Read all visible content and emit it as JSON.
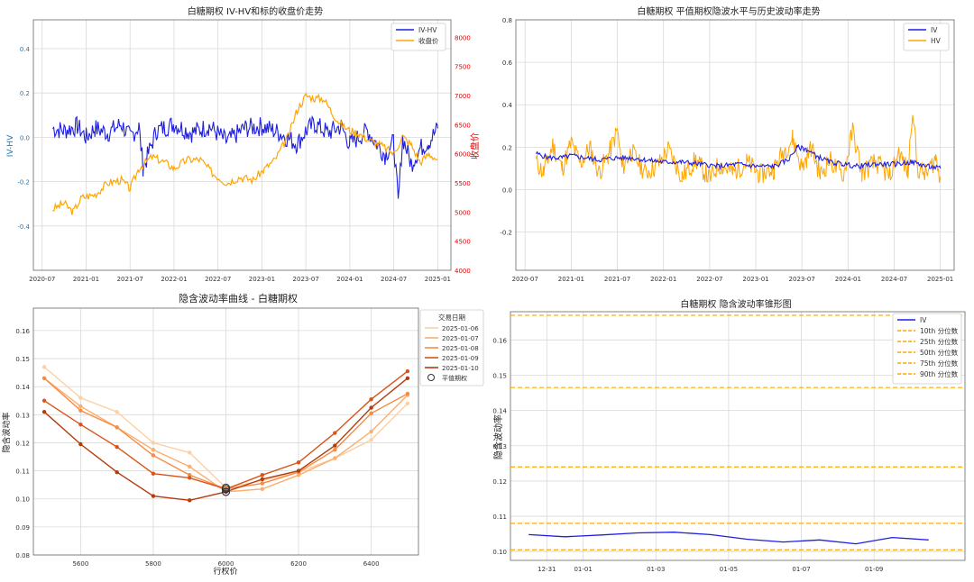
{
  "chart_data": [
    {
      "type": "line",
      "title": "白糖期权 IV-HV和标的收盘价走势",
      "ylabel": "IV-HV",
      "y2label": "收盘价",
      "ylim": [
        -0.6,
        0.53
      ],
      "y2lim": [
        4000,
        8300
      ],
      "yticks": [
        "-0.4",
        "-0.2",
        "0.0",
        "0.2",
        "0.4"
      ],
      "y2ticks": [
        "4000",
        "4500",
        "5000",
        "5500",
        "6000",
        "6500",
        "7000",
        "7500",
        "8000"
      ],
      "xticks": [
        "2020-07",
        "2021-01",
        "2021-07",
        "2022-01",
        "2022-07",
        "2023-01",
        "2023-07",
        "2024-01",
        "2024-07",
        "2025-01"
      ],
      "legend": [
        "IV-HV",
        "收盘价"
      ],
      "legend_position": "top-right",
      "grid": true,
      "colors": {
        "series1": "#1f1fe0",
        "series2": "#ffa500",
        "left_axis": "#1f77b4",
        "right_axis": "#e00000"
      },
      "series": [
        {
          "name": "IV-HV",
          "x": [
            2020.62,
            2020.75,
            2020.9,
            2021.0,
            2021.1,
            2021.25,
            2021.4,
            2021.5,
            2021.6,
            2021.65,
            2021.8,
            2022.0,
            2022.2,
            2022.4,
            2022.6,
            2022.8,
            2023.0,
            2023.2,
            2023.4,
            2023.5,
            2023.6,
            2023.75,
            2023.9,
            2024.0,
            2024.2,
            2024.4,
            2024.5,
            2024.55,
            2024.6,
            2024.7,
            2024.8,
            2024.9,
            2025.0
          ],
          "values": [
            0.04,
            0.03,
            0.05,
            0.0,
            0.04,
            0.02,
            0.06,
            0.0,
            0.05,
            -0.14,
            0.03,
            0.06,
            0.02,
            0.05,
            -0.02,
            0.04,
            0.05,
            0.02,
            -0.03,
            0.03,
            0.06,
            0.02,
            0.05,
            -0.03,
            0.03,
            -0.08,
            -0.02,
            -0.3,
            0.0,
            -0.12,
            -0.05,
            -0.02,
            0.04
          ]
        },
        {
          "name": "收盘价",
          "x": [
            2020.62,
            2020.75,
            2020.85,
            2020.95,
            2021.1,
            2021.25,
            2021.4,
            2021.5,
            2021.6,
            2021.75,
            2021.9,
            2022.0,
            2022.15,
            2022.3,
            2022.45,
            2022.6,
            2022.75,
            2022.9,
            2023.0,
            2023.15,
            2023.3,
            2023.4,
            2023.5,
            2023.6,
            2023.7,
            2023.8,
            2023.9,
            2024.0,
            2024.1,
            2024.2,
            2024.35,
            2024.5,
            2024.6,
            2024.7,
            2024.8,
            2024.9,
            2025.0
          ],
          "values": [
            5050,
            5150,
            5000,
            5250,
            5300,
            5500,
            5550,
            5400,
            5750,
            5950,
            5850,
            5750,
            5900,
            5900,
            5650,
            5500,
            5600,
            5550,
            5700,
            5900,
            6300,
            6750,
            7000,
            6950,
            6950,
            6700,
            6500,
            6400,
            6350,
            6250,
            6150,
            6000,
            6300,
            6150,
            5850,
            6000,
            5900
          ]
        }
      ]
    },
    {
      "type": "line",
      "title": "白糖期权 平值期权隐波水平与历史波动率走势",
      "ylim": [
        -0.38,
        0.8
      ],
      "yticks": [
        "-0.2",
        "0.0",
        "0.2",
        "0.4",
        "0.6",
        "0.8"
      ],
      "xticks": [
        "2020-07",
        "2021-01",
        "2021-07",
        "2022-01",
        "2022-07",
        "2023-01",
        "2023-07",
        "2024-01",
        "2024-07",
        "2025-01"
      ],
      "legend": [
        "IV",
        "HV"
      ],
      "legend_position": "top-right",
      "grid": true,
      "colors": {
        "series1": "#1f1fe0",
        "series2": "#ffa500"
      },
      "series": [
        {
          "name": "IV",
          "x": [
            2020.62,
            2020.75,
            2020.9,
            2021.0,
            2021.15,
            2021.3,
            2021.5,
            2021.65,
            2021.8,
            2022.0,
            2022.2,
            2022.4,
            2022.6,
            2022.8,
            2023.0,
            2023.2,
            2023.35,
            2023.45,
            2023.55,
            2023.65,
            2023.8,
            2023.95,
            2024.1,
            2024.3,
            2024.5,
            2024.7,
            2024.85,
            2025.0
          ],
          "values": [
            0.17,
            0.15,
            0.15,
            0.16,
            0.15,
            0.14,
            0.15,
            0.15,
            0.14,
            0.13,
            0.13,
            0.12,
            0.11,
            0.12,
            0.11,
            0.11,
            0.14,
            0.2,
            0.19,
            0.16,
            0.13,
            0.12,
            0.11,
            0.12,
            0.12,
            0.13,
            0.11,
            0.1
          ]
        },
        {
          "name": "HV",
          "x": [
            2020.62,
            2020.7,
            2020.8,
            2020.9,
            2021.0,
            2021.1,
            2021.2,
            2021.3,
            2021.4,
            2021.5,
            2021.55,
            2021.65,
            2021.8,
            2021.95,
            2022.05,
            2022.2,
            2022.35,
            2022.5,
            2022.6,
            2022.75,
            2022.9,
            2023.05,
            2023.2,
            2023.3,
            2023.4,
            2023.5,
            2023.6,
            2023.7,
            2023.8,
            2023.95,
            2024.05,
            2024.15,
            2024.3,
            2024.45,
            2024.55,
            2024.65,
            2024.7,
            2024.75,
            2024.85,
            2024.95,
            2025.0
          ],
          "values": [
            0.13,
            0.08,
            0.21,
            0.1,
            0.22,
            0.12,
            0.2,
            0.08,
            0.16,
            0.28,
            0.1,
            0.18,
            0.08,
            0.12,
            0.19,
            0.06,
            0.14,
            0.05,
            0.12,
            0.08,
            0.13,
            0.07,
            0.1,
            0.18,
            0.24,
            0.1,
            0.2,
            0.07,
            0.14,
            0.06,
            0.28,
            0.08,
            0.13,
            0.06,
            0.18,
            0.08,
            0.4,
            0.1,
            0.07,
            0.15,
            0.06
          ]
        }
      ]
    },
    {
      "type": "line",
      "title": "隐含波动率曲线 - 白糖期权",
      "xlabel": "行权价",
      "ylabel": "隐含波动率",
      "xlim": [
        5470,
        6530
      ],
      "ylim": [
        0.08,
        0.168
      ],
      "xticks": [
        "5600",
        "5800",
        "6000",
        "6200",
        "6400"
      ],
      "yticks": [
        "0.08",
        "0.09",
        "0.10",
        "0.11",
        "0.12",
        "0.13",
        "0.14",
        "0.15",
        "0.16"
      ],
      "legend_title": "交易日期",
      "legend_position": "top-right",
      "marker_label": "平值期权",
      "grid": true,
      "categories": [
        5500,
        5600,
        5700,
        5800,
        5900,
        6000,
        6100,
        6200,
        6300,
        6400,
        6500
      ],
      "series": [
        {
          "name": "2025-01-06",
          "color": "#fdd0a2",
          "values": [
            0.147,
            0.136,
            0.131,
            0.12,
            0.1165,
            0.104,
            0.1065,
            0.1095,
            0.1145,
            0.121,
            0.134
          ]
        },
        {
          "name": "2025-01-07",
          "color": "#fdae6b",
          "values": [
            0.143,
            0.133,
            0.1255,
            0.1175,
            0.1115,
            0.1025,
            0.1035,
            0.1085,
            0.1145,
            0.124,
            0.137
          ]
        },
        {
          "name": "2025-01-08",
          "color": "#f58c46",
          "values": [
            0.143,
            0.1315,
            0.1255,
            0.1155,
            0.1085,
            0.1035,
            0.1055,
            0.1095,
            0.1175,
            0.1305,
            0.1375
          ]
        },
        {
          "name": "2025-01-09",
          "color": "#d9541a",
          "values": [
            0.135,
            0.1265,
            0.1185,
            0.109,
            0.1075,
            0.1035,
            0.1085,
            0.113,
            0.1235,
            0.1355,
            0.1455
          ]
        },
        {
          "name": "2025-01-10",
          "color": "#b23c0b",
          "values": [
            0.131,
            0.1195,
            0.1095,
            0.101,
            0.0995,
            0.1025,
            0.107,
            0.11,
            0.119,
            0.1325,
            0.143
          ]
        }
      ],
      "atm": {
        "x": 6000,
        "values": [
          0.104,
          0.1025,
          0.1035,
          0.1035,
          0.1025
        ]
      }
    },
    {
      "type": "line",
      "title": "白糖期权 隐含波动率锥形图",
      "ylabel": "隐含波动率",
      "ylim": [
        0.0975,
        0.168
      ],
      "yticks": [
        "0.10",
        "0.11",
        "0.12",
        "0.13",
        "0.14",
        "0.15",
        "0.16"
      ],
      "xticks": [
        {
          "label": "12-31",
          "pos": 1.0
        },
        {
          "label": "01-01",
          "pos": 2.0
        },
        {
          "label": "01-03",
          "pos": 4.0
        },
        {
          "label": "01-05",
          "pos": 6.0
        },
        {
          "label": "01-07",
          "pos": 8.0
        },
        {
          "label": "01-09",
          "pos": 10.0
        }
      ],
      "xlim": [
        0.0,
        12.5
      ],
      "legend_position": "top-right",
      "grid": true,
      "colors": {
        "iv": "#1f1fe0",
        "percentile": "#ffa500"
      },
      "series": [
        {
          "name": "IV",
          "x": [
            0.5,
            1.5,
            2.5,
            3.5,
            4.5,
            5.5,
            6.5,
            7.5,
            8.5,
            9.5,
            10.5,
            11.5
          ],
          "values": [
            0.1048,
            0.1042,
            0.1047,
            0.1053,
            0.1055,
            0.1048,
            0.1035,
            0.1027,
            0.1033,
            0.1022,
            0.104,
            0.1033
          ]
        }
      ],
      "percentiles": [
        {
          "name": "10th 分位数",
          "value": 0.1005
        },
        {
          "name": "25th 分位数",
          "value": 0.108
        },
        {
          "name": "50th 分位数",
          "value": 0.124
        },
        {
          "name": "75th 分位数",
          "value": 0.1465
        },
        {
          "name": "90th 分位数",
          "value": 0.167
        }
      ]
    }
  ]
}
